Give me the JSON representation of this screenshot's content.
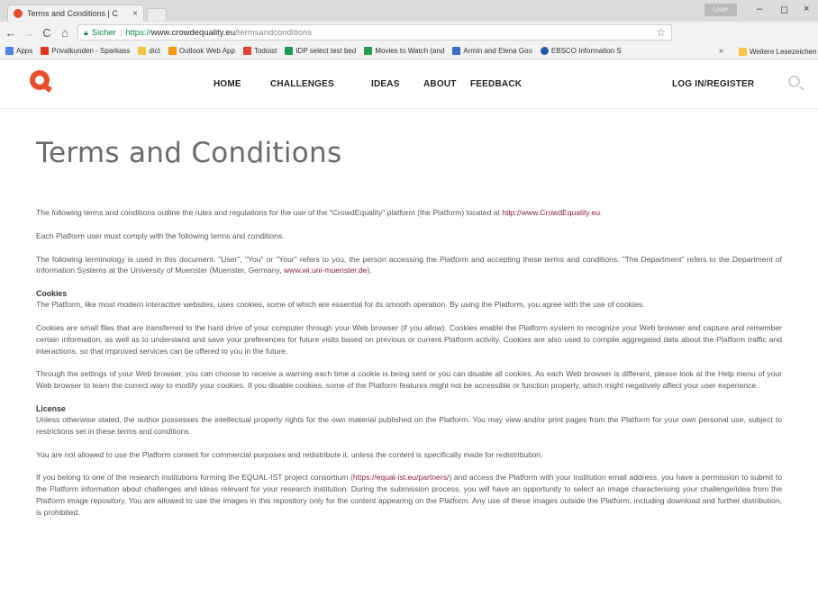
{
  "browser": {
    "tab_title": "Terms and Conditions | C",
    "tab_close": "×",
    "user_chip": "User",
    "win_minimize": "–",
    "win_maximize": "◻",
    "win_close": "×",
    "nav_back": "←",
    "nav_forward": "→",
    "nav_reload": "C",
    "nav_home": "⌂",
    "secure_label": "Sicher",
    "url_scheme": "https://",
    "url_host": "www.crowdequality.eu",
    "url_path": "/termsandconditions",
    "bookmarks": [
      {
        "label": "Apps",
        "color": "#4a86e8"
      },
      {
        "label": "Privatkunden - Sparkass",
        "color": "#e8341c"
      },
      {
        "label": "dict",
        "color": "#f4c542"
      },
      {
        "label": "Outlook Web App",
        "color": "#f29b00"
      },
      {
        "label": "Todoist",
        "color": "#e44332"
      },
      {
        "label": "IDP select test bed",
        "color": "#1f9d55"
      },
      {
        "label": "Movies to Watch (and",
        "color": "#2e9b47"
      },
      {
        "label": "Armin and Elena Goo",
        "color": "#3a6fc4"
      },
      {
        "label": "EBSCO Information S",
        "color": "#1e5aa8"
      }
    ],
    "bookmarks_more": "»",
    "other_bookmarks": "Weitere Lesezeichen"
  },
  "site": {
    "nav": {
      "home": "HOME",
      "challenges": "CHALLENGES",
      "ideas": "IDEAS",
      "about": "ABOUT",
      "feedback": "FEEDBACK",
      "login": "LOG IN/REGISTER"
    },
    "accent_color": "#e84c2b",
    "link_color": "#8a1c43"
  },
  "page": {
    "title": "Terms and Conditions",
    "p1_text": "The following terms and conditions outline the rules and regulations for the use of the \"CrowdEquality\" platform (the Platform) located at ",
    "p1_link": "http://www.CrowdEquality.eu",
    "p1_end": ".",
    "p2": "Each Platform user must comply with the following terms and conditions.",
    "p3_text": "The following terminology is used in this document. \"User\", \"You\" or \"Your\" refers to you, the person accessing the Platform and accepting these terms and conditions. \"The Department\" refers to the Department of Information Systems at the University of Muenster (Muenster, Germany, ",
    "p3_link": "www.wi.uni-muenster.de",
    "p3_end": ").",
    "cookies_heading": "Cookies",
    "cookies_p1": "The Platform, like most modern interactive websites, uses cookies, some of which are essential for its smooth operation. By using the Platform, you agree with the use of cookies.",
    "cookies_p2": "Cookies are small files that are transferred to the hard drive of your computer through your Web browser (if you allow). Cookies enable the Platform system to recognize your Web browser and capture and remember certain information, as well as to understand and save your preferences for future visits based on previous or current Platform activity. Cookies are also used to compile aggregated data about the Platform traffic and interactions, so that improved services can be offered to you in the future.",
    "cookies_p3": "Through the settings of your Web browser, you can choose to receive a warning each time a cookie is being sent or you can disable all cookies. As each Web browser is different, please look at the Help menu of your Web browser to learn the correct way to modify your cookies. If you disable cookies, some of the Platform features might not be accessible or function properly, which might negatively affect your user experience.",
    "license_heading": "License",
    "license_p1": "Unless otherwise stated, the author possesses the intellectual property rights for the own material published on the Platform. You may view and/or print pages from the Platform for your own personal use, subject to restrictions set in these terms and conditions.",
    "license_p2": "You are not allowed to use the Platform content for commercial purposes and redistribute it, unless the content is specifically made for redistribution.",
    "license_p3_text": "If you belong to one of the research institutions forming the EQUAL-IST project consortium (",
    "license_p3_link": "https://equal-ist.eu/partners/",
    "license_p3_end": ") and access the Platform with your institution email address, you have a permission to submit to the Platform information about challenges and ideas relevant for your research institution. During the submission process, you will have an opportunity to select an image characterising your challenge/idea from the Platform image repository. You are allowed to use the images in this repository only for the content appearing on the Platform. Any use of these images outside the Platform, including download and further distribution, is prohibited."
  }
}
